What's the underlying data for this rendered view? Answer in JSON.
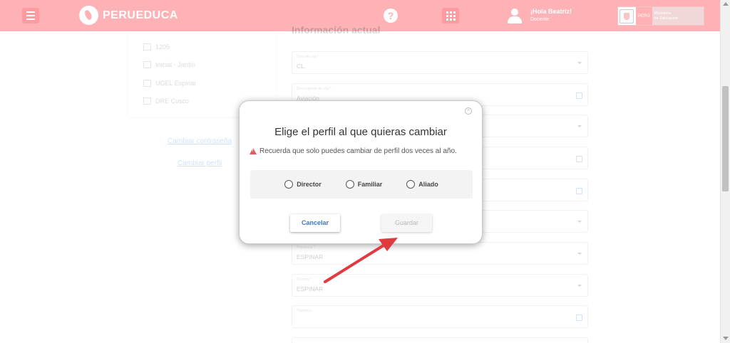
{
  "header": {
    "logo_text": "PERUEDUCA",
    "help_label": "?",
    "user_greeting": "¡Hola Beatriz!",
    "user_role": "Docente",
    "ministry_country": "PERÚ",
    "ministry_line1": "Ministerio",
    "ministry_line2": "de Educación"
  },
  "sidebar": {
    "info": [
      {
        "text": "1205",
        "icon": "school-icon"
      },
      {
        "text": "Inicial - Jardín",
        "icon": "level-icon"
      },
      {
        "text": "UGEL Espinar",
        "icon": "building-icon"
      },
      {
        "text": "DRE Cusco",
        "icon": "building-icon"
      }
    ],
    "change_password": "Cambiar contraseña",
    "change_profile": "Cambiar perfil"
  },
  "form": {
    "section_title": "Información actual",
    "fields": [
      {
        "label": "Tipo de vía *",
        "value": "CL."
      },
      {
        "label": "Descripción de vía *",
        "value": "Aviación"
      },
      {
        "label": "",
        "value": ""
      },
      {
        "label": "",
        "value": ""
      },
      {
        "label": "",
        "value": ""
      },
      {
        "label": "",
        "value": ""
      },
      {
        "label": "Provincia *",
        "value": "ESPINAR"
      },
      {
        "label": "Distrito *",
        "value": "ESPINAR"
      },
      {
        "label": "Teléfono",
        "value": ""
      }
    ]
  },
  "modal": {
    "close_label": "×",
    "title": "Elige el perfil al que quieras cambiar",
    "warning": "Recuerda que solo puedes cambiar de perfil dos veces al año.",
    "options": [
      "Director",
      "Familiar",
      "Aliado"
    ],
    "cancel_label": "Cancelar",
    "save_label": "Guardar"
  },
  "colors": {
    "header": "#ffb2b6",
    "link": "#4a90e2",
    "cancel_text": "#3a78c3",
    "annotation_arrow": "#e0393e"
  }
}
